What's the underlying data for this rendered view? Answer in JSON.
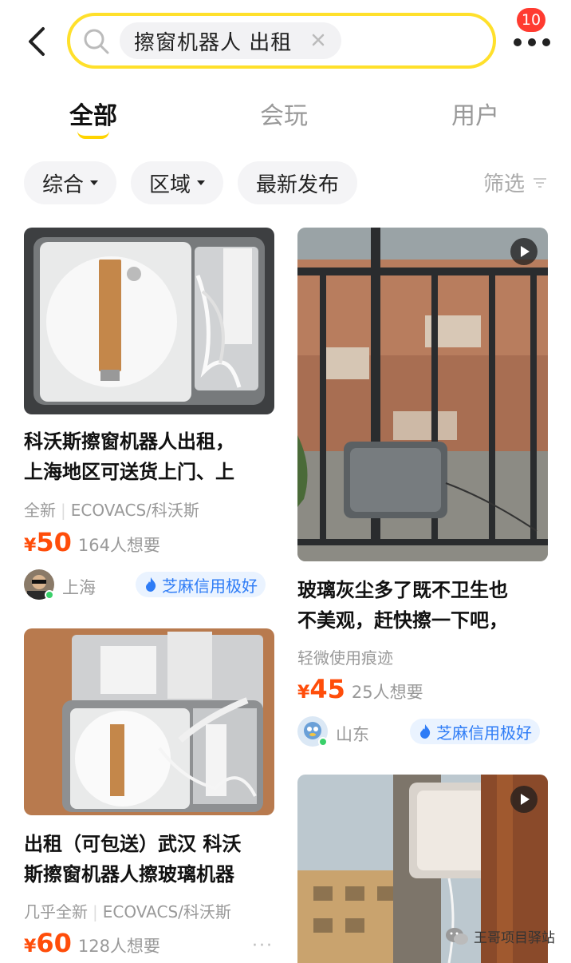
{
  "header": {
    "search_query": "擦窗机器人 出租",
    "notification_count": "10",
    "icons": [
      "back-arrow-icon",
      "search-icon",
      "clear-icon",
      "more-dots-icon"
    ]
  },
  "tabs": [
    {
      "label": "全部",
      "active": true
    },
    {
      "label": "会玩",
      "active": false
    },
    {
      "label": "用户",
      "active": false
    }
  ],
  "filters": {
    "sort_label": "综合",
    "region_label": "区域",
    "latest_label": "最新发布",
    "filter_label": "筛选"
  },
  "colors": {
    "search_border": "#ffe02b",
    "price": "#ff4d0a",
    "credit_text": "#2e7cf6",
    "credit_bg": "#eaf3ff",
    "badge": "#ff3b30"
  },
  "listings": [
    {
      "title_line1": "科沃斯擦窗机器人出租，",
      "title_line2": "上海地区可送货上门、上",
      "condition": "全新",
      "brand": "ECOVACS/科沃斯",
      "price_symbol": "¥",
      "price": "50",
      "wants": "164人想要",
      "location": "上海",
      "credit": "芝麻信用极好"
    },
    {
      "title_line1": "玻璃灰尘多了既不卫生也",
      "title_line2": "不美观，赶快擦一下吧，",
      "condition": "轻微使用痕迹",
      "price_symbol": "¥",
      "price": "45",
      "wants": "25人想要",
      "location": "山东",
      "credit": "芝麻信用极好",
      "video": true
    },
    {
      "title_line1": "出租（可包送）武汉 科沃",
      "title_line2": "斯擦窗机器人擦玻璃机器",
      "condition": "几乎全新",
      "brand": "ECOVACS/科沃斯",
      "price_symbol": "¥",
      "price": "60",
      "wants": "128人想要",
      "more": "···"
    },
    {
      "video": true
    }
  ],
  "watermark": "王哥项目驿站"
}
